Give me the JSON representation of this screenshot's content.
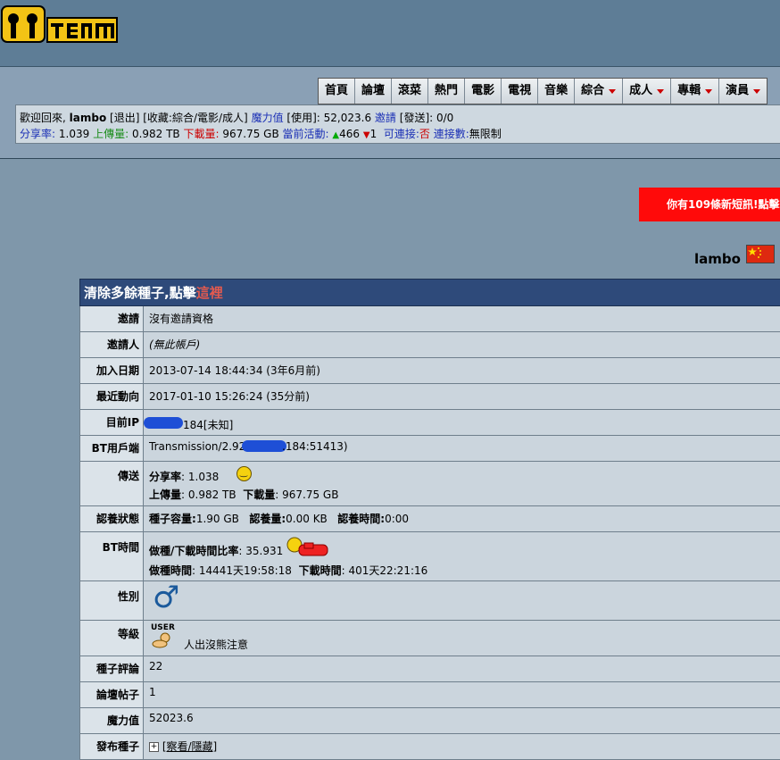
{
  "brand": {
    "logo_text": "MTeam"
  },
  "nav": [
    {
      "label": "首頁",
      "dropdown": false
    },
    {
      "label": "論壇",
      "dropdown": false
    },
    {
      "label": "滾菜",
      "dropdown": false
    },
    {
      "label": "熱門",
      "dropdown": false
    },
    {
      "label": "電影",
      "dropdown": false
    },
    {
      "label": "電視",
      "dropdown": false
    },
    {
      "label": "音樂",
      "dropdown": false
    },
    {
      "label": "綜合",
      "dropdown": true
    },
    {
      "label": "成人",
      "dropdown": true
    },
    {
      "label": "專輯",
      "dropdown": true
    },
    {
      "label": "演員",
      "dropdown": true
    }
  ],
  "userbar": {
    "welcome": "歡迎回來,",
    "username": "lambo",
    "logout": "[退出]",
    "favorites": "[收藏:綜合/電影/成人]",
    "bonus_label": "魔力值",
    "bonus_value": "[使用]: 52,023.6",
    "invite_label": "邀請",
    "invite_value": "[發送]: 0/0",
    "ratio_label": "分享率:",
    "ratio_value": "1.039",
    "upload_label": "上傳量:",
    "upload_value": "0.982 TB",
    "download_label": "下載量:",
    "download_value": "967.75 GB",
    "activity_label": "當前活動:",
    "seeding_count": "466",
    "leeching_count": "1",
    "connectable_label": "可連接:",
    "connectable_value": "否",
    "connections_label": "連接數:",
    "connections_value": "無限制"
  },
  "messages": {
    "banner": "你有109條新短訊!點擊"
  },
  "profile": {
    "username": "lambo",
    "header_text": "清除多餘種子,點擊",
    "header_link": "這裡",
    "rows": {
      "invite": {
        "label": "邀請",
        "value": "沒有邀請資格"
      },
      "inviter": {
        "label": "邀請人",
        "value": "(無此帳戶)"
      },
      "joined": {
        "label": "加入日期",
        "value": "2013-07-14 18:44:34 (3年6月前)"
      },
      "last_action": {
        "label": "最近動向",
        "value": "2017-01-10 15:26:24 (35分前)"
      },
      "ip": {
        "label": "目前IP",
        "value": "184[未知]"
      },
      "client": {
        "label": "BT用戶端",
        "value_pre": "Transmission/2.92",
        "value_post": ".184:51413)"
      },
      "transfer": {
        "label": "傳送",
        "ratio_label": "分享率",
        "ratio_value": ": 1.038",
        "upload_label": "上傳量",
        "upload_value": ": 0.982 TB",
        "download_label": "下載量",
        "download_value": ": 967.75 GB"
      },
      "certify": {
        "label": "認養狀態",
        "size_label": "種子容量:",
        "size_value": "1.90 GB",
        "amount_label": "認養量:",
        "amount_value": "0.00 KB",
        "time_label": "認養時間:",
        "time_value": "0:00"
      },
      "bt_time": {
        "label": "BT時間",
        "ratio_label": "做種/下載時間比率",
        "ratio_value": ": 35.931",
        "seed_label": "做種時間",
        "seed_value": ": 14441天19:58:18",
        "leech_label": "下載時間",
        "leech_value": ": 401天22:21:16"
      },
      "gender": {
        "label": "性別",
        "symbol": "♂"
      },
      "class": {
        "label": "等級",
        "badge": "USER",
        "note": "人出沒熊注意"
      },
      "comments": {
        "label": "種子評論",
        "value": "22"
      },
      "forum_posts": {
        "label": "論壇帖子",
        "value": "1"
      },
      "bonus": {
        "label": "魔力值",
        "value": "52023.6"
      },
      "uploaded": {
        "label": "發布種子",
        "toggle": "[察看/隱藏]"
      }
    }
  },
  "colors": {
    "header_bg": "#5e7d96",
    "page_bg": "#7f97aa",
    "table_head": "#2e4a7a",
    "banner": "#ff0a0a"
  }
}
